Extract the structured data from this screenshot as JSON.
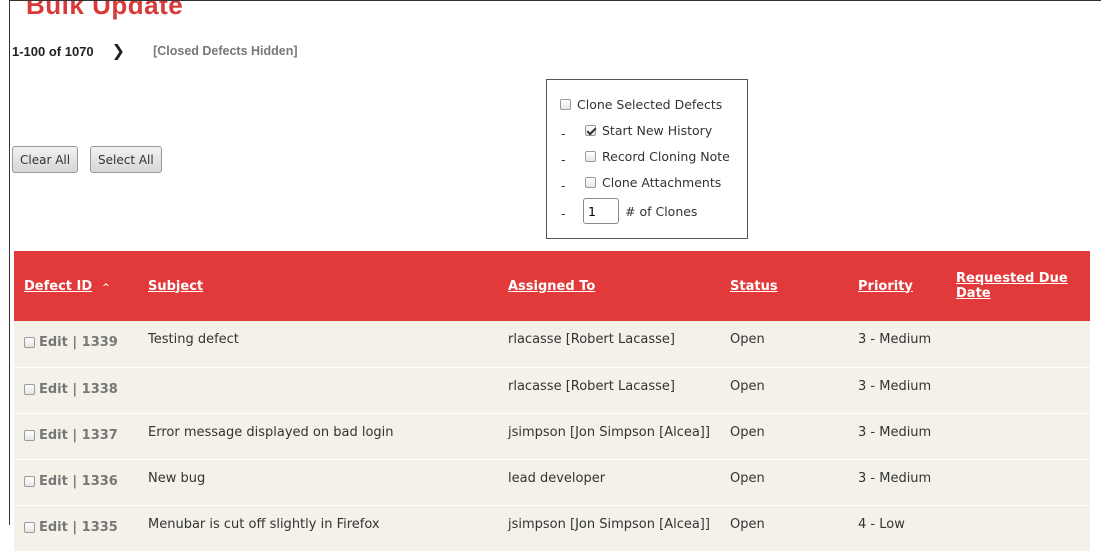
{
  "header": {
    "title": "Bulk Update",
    "range": "1-100 of 1070",
    "next_icon": "chevron-right-icon",
    "hidden_note": "[Closed Defects Hidden]"
  },
  "buttons": {
    "clear_all": "Clear All",
    "select_all": "Select All"
  },
  "clone_options": {
    "clone_selected": {
      "label": "Clone Selected Defects",
      "checked": false
    },
    "dash": "-",
    "start_new_history": {
      "label": "Start New History",
      "checked": true
    },
    "record_cloning_note": {
      "label": "Record Cloning Note",
      "checked": false
    },
    "clone_attachments": {
      "label": "Clone Attachments",
      "checked": false
    },
    "num_clones": {
      "value": "1",
      "label": "# of Clones"
    }
  },
  "table": {
    "header_color": "#e23a3a",
    "columns": {
      "defect_id": "Defect ID",
      "subject": "Subject",
      "assigned_to": "Assigned To",
      "status": "Status",
      "priority": "Priority",
      "requested_due_date": "Requested Due Date"
    },
    "sort_icon": "sort-asc-icon",
    "rows": [
      {
        "edit": "Edit",
        "sep": "|",
        "id": "1339",
        "subject": "Testing defect",
        "assigned": "rlacasse [Robert Lacasse]",
        "status": "Open",
        "priority": "3 - Medium",
        "due": ""
      },
      {
        "edit": "Edit",
        "sep": "|",
        "id": "1338",
        "subject": "",
        "assigned": "rlacasse [Robert Lacasse]",
        "status": "Open",
        "priority": "3 - Medium",
        "due": ""
      },
      {
        "edit": "Edit",
        "sep": "|",
        "id": "1337",
        "subject": "Error message displayed on bad login",
        "assigned": "jsimpson [Jon Simpson [Alcea]]",
        "status": "Open",
        "priority": "3 - Medium",
        "due": ""
      },
      {
        "edit": "Edit",
        "sep": "|",
        "id": "1336",
        "subject": "New bug",
        "assigned": "lead developer",
        "status": "Open",
        "priority": "3 - Medium",
        "due": ""
      },
      {
        "edit": "Edit",
        "sep": "|",
        "id": "1335",
        "subject": "Menubar is cut off slightly in Firefox",
        "assigned": "jsimpson [Jon Simpson [Alcea]]",
        "status": "Open",
        "priority": "4 - Low",
        "due": ""
      }
    ]
  }
}
